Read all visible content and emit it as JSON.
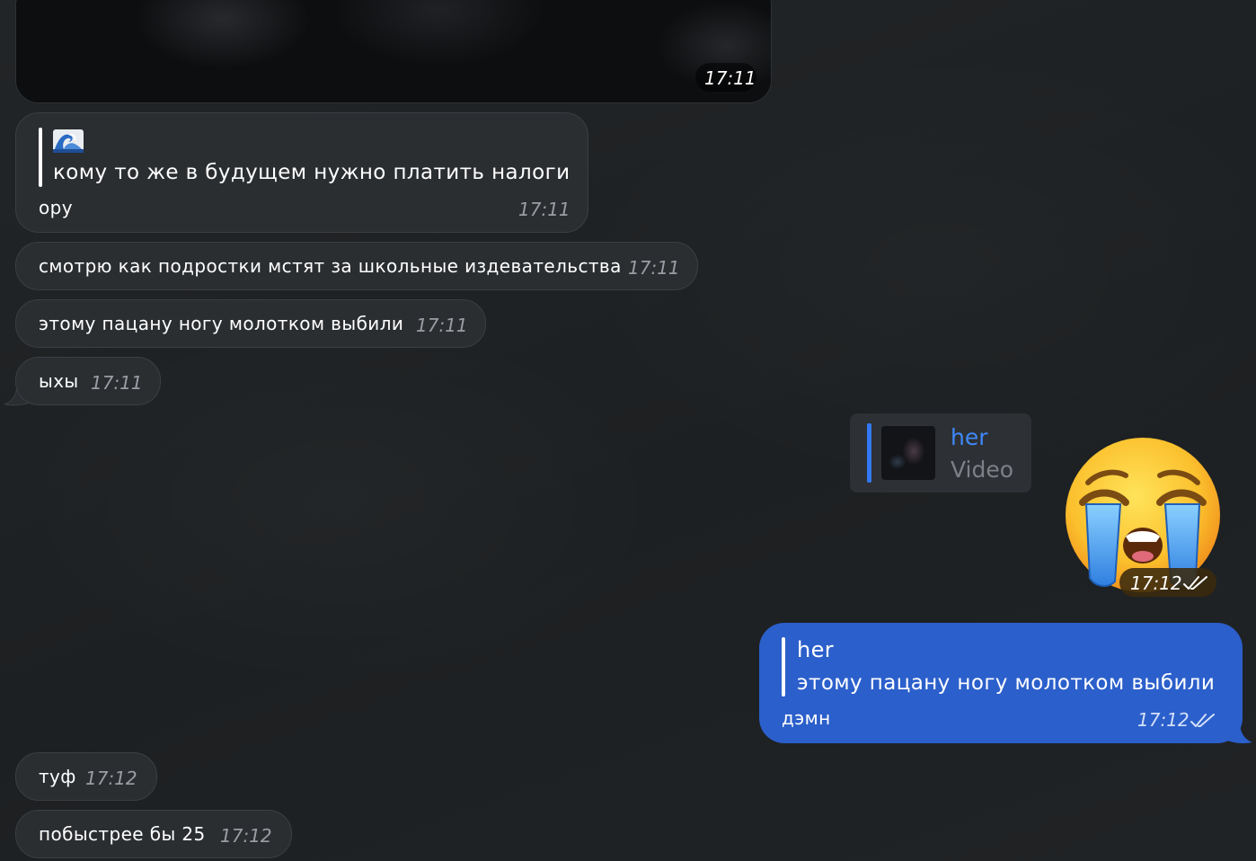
{
  "video_message": {
    "time": "17:11"
  },
  "messages_in": [
    {
      "quote": {
        "icon": "wave-emoji-icon",
        "text": "кому то же в будущем нужно платить налоги"
      },
      "text": "ору",
      "time": "17:11"
    },
    {
      "text": "смотрю как подростки мстят за школьные издевательства",
      "time": "17:11"
    },
    {
      "text": "этому пацану ногу молотком выбили",
      "time": "17:11"
    },
    {
      "text": "ыхы",
      "time": "17:11"
    },
    {
      "text": "туф",
      "time": "17:12"
    },
    {
      "text": "побыстрее бы 25",
      "time": "17:12"
    }
  ],
  "sticker_message": {
    "reply": {
      "name": "her",
      "media_label": "Video"
    },
    "sticker": "loudly-crying-face-emoji",
    "time": "17:12",
    "status": "read-double-check-icon"
  },
  "out_message": {
    "reply": {
      "name": "her",
      "text": "этому пацану ногу молотком выбили"
    },
    "text": "дэмн",
    "time": "17:12",
    "status": "read-double-check-icon"
  },
  "colors": {
    "background": "#1f2224",
    "incoming_bubble": "#2b2e31",
    "outgoing_bubble": "#2b5fcb",
    "accent": "#3478f6",
    "time_text": "#9a9ea4"
  }
}
